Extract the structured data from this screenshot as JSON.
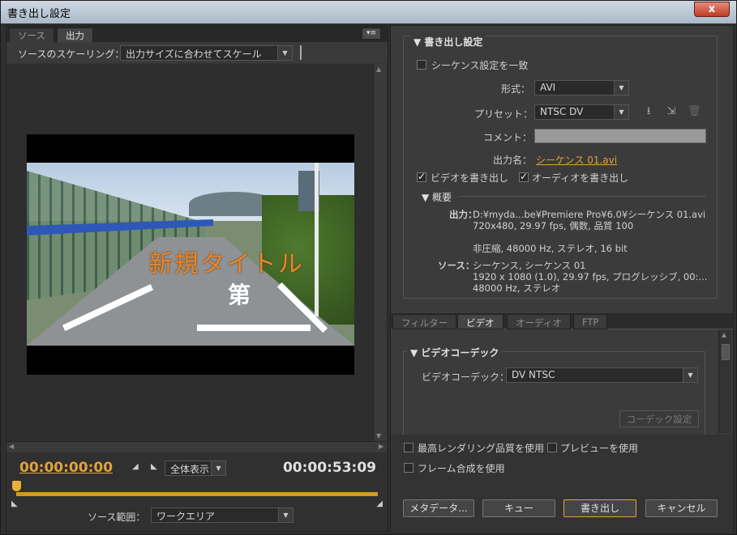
{
  "window": {
    "title": "書き出し設定",
    "close_glyph": "x"
  },
  "left": {
    "tabs": [
      {
        "label": "ソース"
      },
      {
        "label": "出力"
      }
    ],
    "panel_menu_glyph": "▾≡",
    "scaling_label": "ソースのスケーリング：",
    "scaling_value": "出力サイズに合わせてスケール",
    "overlay_title": "新規タイトル",
    "road_marking": "第",
    "timecode_current": "00:00:00:00",
    "timecode_duration": "00:00:53:09",
    "zoom_value": "全体表示",
    "source_range_label": "ソース範囲：",
    "source_range_value": "ワークエリア"
  },
  "export": {
    "section_title": "書き出し設定",
    "match_sequence": "シーケンス設定を一致",
    "format_label": "形式：",
    "format_value": "AVI",
    "preset_label": "プリセット：",
    "preset_value": "NTSC DV",
    "comment_label": "コメント：",
    "output_name_label": "出力名：",
    "output_name_value": "シーケンス 01.avi",
    "export_video": "ビデオを書き出し",
    "export_audio": "オーディオを書き出し",
    "summary_title": "概要",
    "output_label": "出力：",
    "output_lines": [
      "D:¥myda...be¥Premiere Pro¥6.0¥シーケンス 01.avi",
      "720x480, 29.97 fps, 偶数, 品質 100",
      "非圧縮, 48000 Hz, ステレオ, 16 bit"
    ],
    "source_label": "ソース：",
    "source_lines": [
      "シーケンス, シーケンス 01",
      "1920 x 1080 (1.0), 29.97 fps, プログレッシブ, 00:...",
      "48000 Hz, ステレオ"
    ]
  },
  "settings_tabs": [
    {
      "label": "フィルター"
    },
    {
      "label": "ビデオ"
    },
    {
      "label": "オーディオ"
    },
    {
      "label": "FTP"
    }
  ],
  "codec": {
    "section_title": "ビデオコーデック",
    "codec_label": "ビデオコーデック：",
    "codec_value": "DV NTSC",
    "codec_settings_button": "コーデック設定"
  },
  "options": {
    "max_render_quality": "最高レンダリング品質を使用",
    "use_previews": "プレビューを使用",
    "frame_blending": "フレーム合成を使用"
  },
  "buttons": {
    "metadata": "メタデータ...",
    "queue": "キュー",
    "export": "書き出し",
    "cancel": "キャンセル"
  },
  "icons": {
    "save_preset": "save-preset-icon",
    "import_preset": "import-preset-icon",
    "delete_preset": "delete-preset-icon"
  }
}
